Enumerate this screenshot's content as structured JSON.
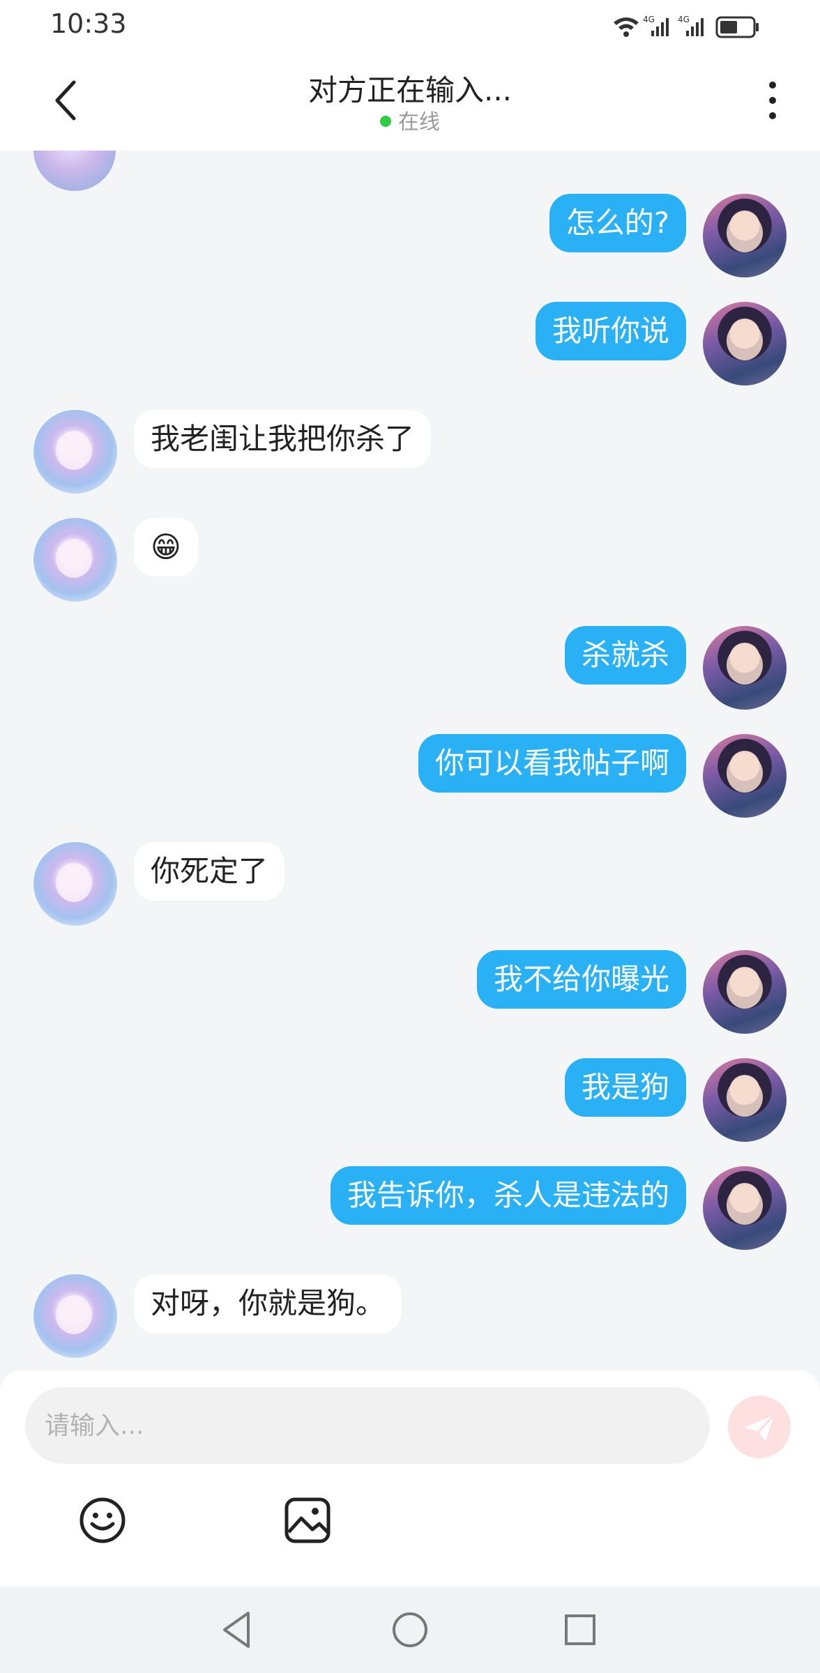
{
  "status_bar": {
    "time": "10:33",
    "network_labels": [
      "4G",
      "4G"
    ]
  },
  "header": {
    "title": "对方正在输入...",
    "status": "在线"
  },
  "messages": [
    {
      "from": "self",
      "text": "怎么的?"
    },
    {
      "from": "self",
      "text": "我听你说"
    },
    {
      "from": "peer",
      "text": "我老闺让我把你杀了"
    },
    {
      "from": "peer",
      "text": "😁"
    },
    {
      "from": "self",
      "text": "杀就杀"
    },
    {
      "from": "self",
      "text": "你可以看我帖子啊"
    },
    {
      "from": "peer",
      "text": "你死定了"
    },
    {
      "from": "self",
      "text": "我不给你曝光"
    },
    {
      "from": "self",
      "text": "我是狗"
    },
    {
      "from": "self",
      "text": "我告诉你，杀人是违法的"
    },
    {
      "from": "peer",
      "text": "对呀，你就是狗。"
    }
  ],
  "composer": {
    "placeholder": "请输入...",
    "icons": [
      "emoji-icon",
      "image-icon",
      "send-icon"
    ]
  },
  "nav_bar": {
    "icons": [
      "back-triangle-icon",
      "home-circle-icon",
      "recents-square-icon"
    ]
  },
  "colors": {
    "self_bubble": "#2ab0f5",
    "peer_bubble": "#ffffff",
    "background": "#f4f5f7",
    "online_dot": "#2ecc40",
    "send_button": "#ffe0e0"
  }
}
